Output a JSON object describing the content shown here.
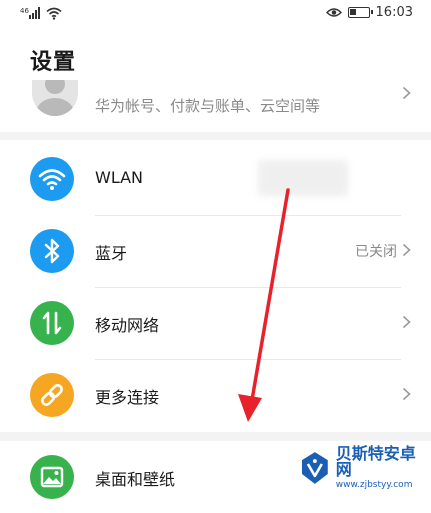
{
  "status_bar": {
    "time": "16:03"
  },
  "header": {
    "title": "设置"
  },
  "account": {
    "subtitle": "华为帐号、付款与账单、云空间等"
  },
  "items": [
    {
      "label": "WLAN",
      "value": "",
      "icon": "wifi-icon",
      "color": "#1d9bf0"
    },
    {
      "label": "蓝牙",
      "value": "已关闭",
      "icon": "bluetooth-icon",
      "color": "#1d9bf0"
    },
    {
      "label": "移动网络",
      "value": "",
      "icon": "mobile-data-icon",
      "color": "#37b24d"
    },
    {
      "label": "更多连接",
      "value": "",
      "icon": "link-icon",
      "color": "#f5a623"
    },
    {
      "label": "桌面和壁纸",
      "value": "",
      "icon": "wallpaper-icon",
      "color": "#37b24d"
    }
  ],
  "watermark": {
    "title": "贝斯特安卓网",
    "url": "www.zjbstyy.com"
  },
  "colors": {
    "arrow": "#e8212b",
    "gap": "#f3f3f3"
  }
}
